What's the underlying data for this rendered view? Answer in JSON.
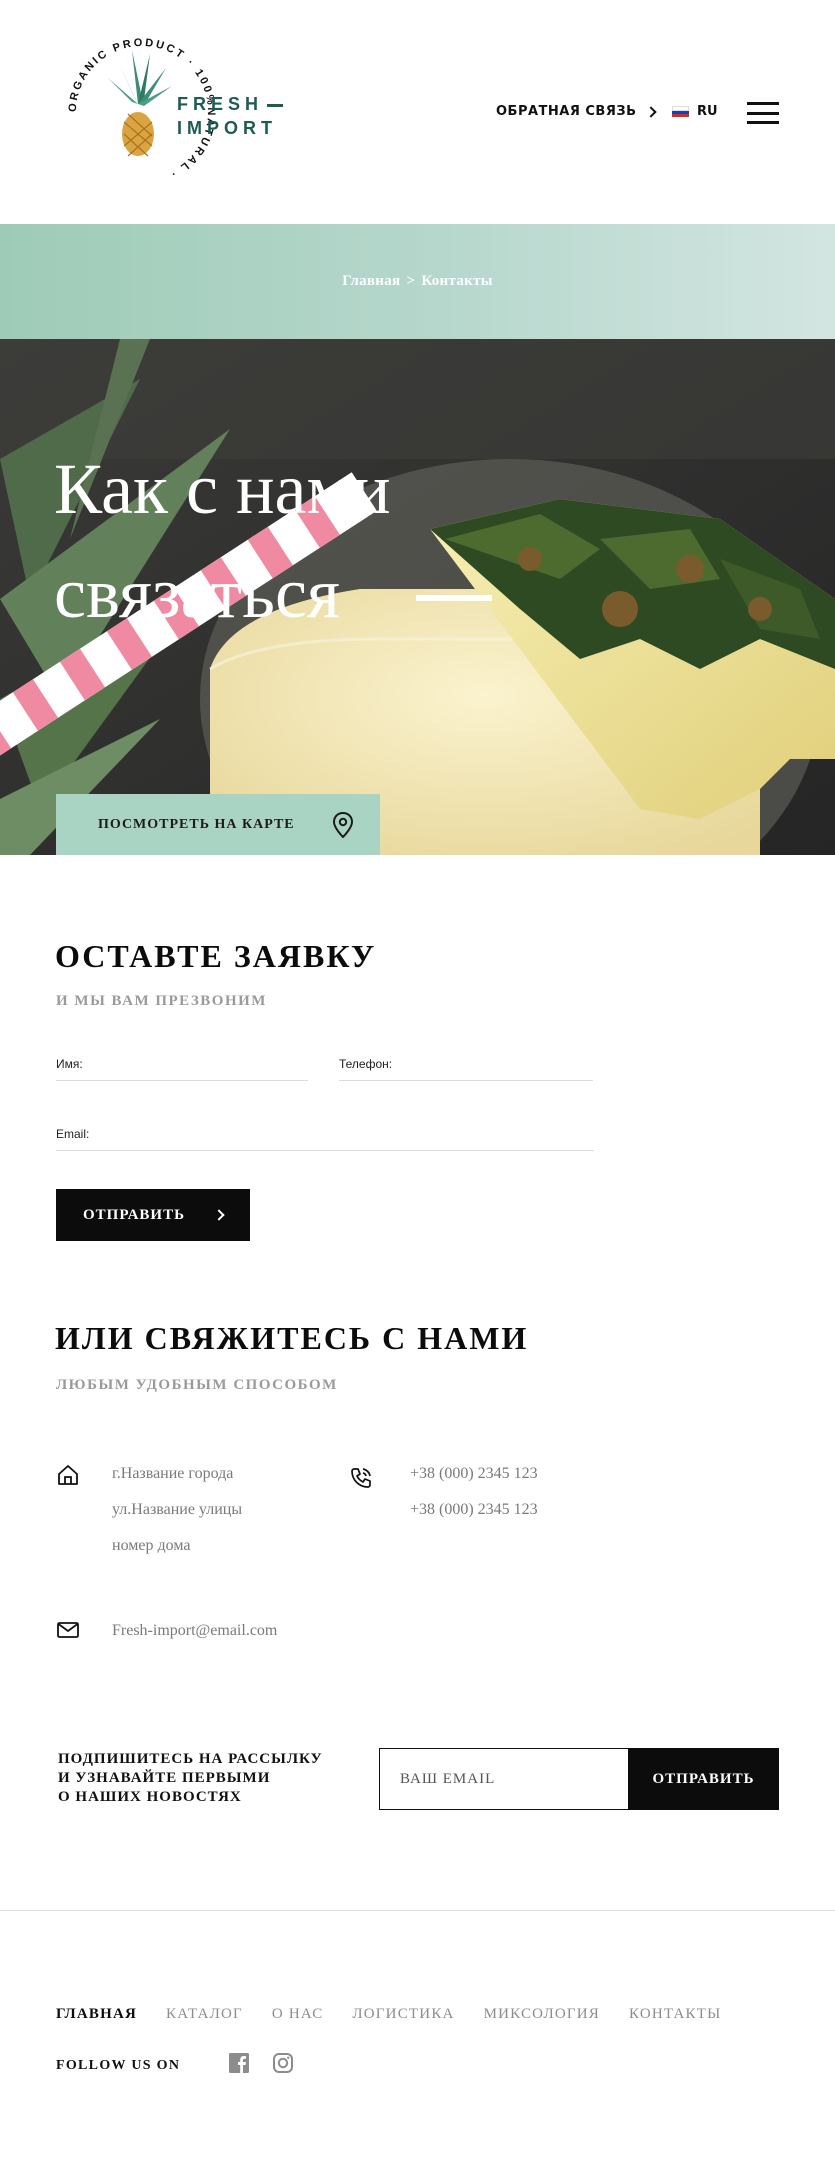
{
  "header": {
    "logo": {
      "ring_text": "ORGANIC PRODUCT · 100%NATURAL ·",
      "word_line1": "FRESH",
      "word_line2": "IMPORT"
    },
    "feedback_label": "ОБРАТНАЯ СВЯЗЬ",
    "language": "RU"
  },
  "breadcrumb": {
    "home": "Главная",
    "separator": ">",
    "current": "Контакты"
  },
  "hero": {
    "title_line1": "Как с нами",
    "title_line2": "связаться",
    "map_button": "ПОСМОТРЕТЬ  НА КАРТЕ"
  },
  "form": {
    "heading": "ОСТАВТЕ ЗАЯВКУ",
    "subheading": "И МЫ ВАМ ПРЕЗВОНИМ",
    "name_label": "Имя:",
    "phone_label": "Телефон:",
    "email_label": "Email:",
    "submit_label": "ОТПРАВИТЬ"
  },
  "contacts": {
    "heading": "ИЛИ СВЯЖИТЕСЬ С НАМИ",
    "subheading": "ЛЮБЫМ УДОБНЫМ СПОСОБОМ",
    "address": [
      "г.Название города",
      "ул.Название улицы",
      "номер дома"
    ],
    "phones": [
      "+38 (000) 2345 123",
      "+38 (000) 2345 123"
    ],
    "email": "Fresh-import@email.com"
  },
  "subscribe": {
    "text_line1": "ПОДПИШИТЕСЬ НА РАССЫЛКУ",
    "text_line2": "И УЗНАВАЙТЕ ПЕРВЫМИ",
    "text_line3": "О НАШИХ НОВОСТЯХ",
    "placeholder": "ВАШ EMAIL",
    "button": "ОТПРАВИТЬ"
  },
  "footer": {
    "nav": [
      {
        "label": "ГЛАВНАЯ",
        "active": true
      },
      {
        "label": "КАТАЛОГ",
        "active": false
      },
      {
        "label": "О НАС",
        "active": false
      },
      {
        "label": "ЛОГИСТИКА",
        "active": false
      },
      {
        "label": "МИКСОЛОГИЯ",
        "active": false
      },
      {
        "label": "КОНТАКТЫ",
        "active": false
      }
    ],
    "follow": "FOLLOW US ON",
    "social_icons": [
      "facebook-icon",
      "instagram-icon"
    ]
  },
  "colors": {
    "brand_green": "#1d5c54",
    "mint": "#a9d3c3",
    "black": "#0c0c0c",
    "muted": "#9a9a9a"
  }
}
